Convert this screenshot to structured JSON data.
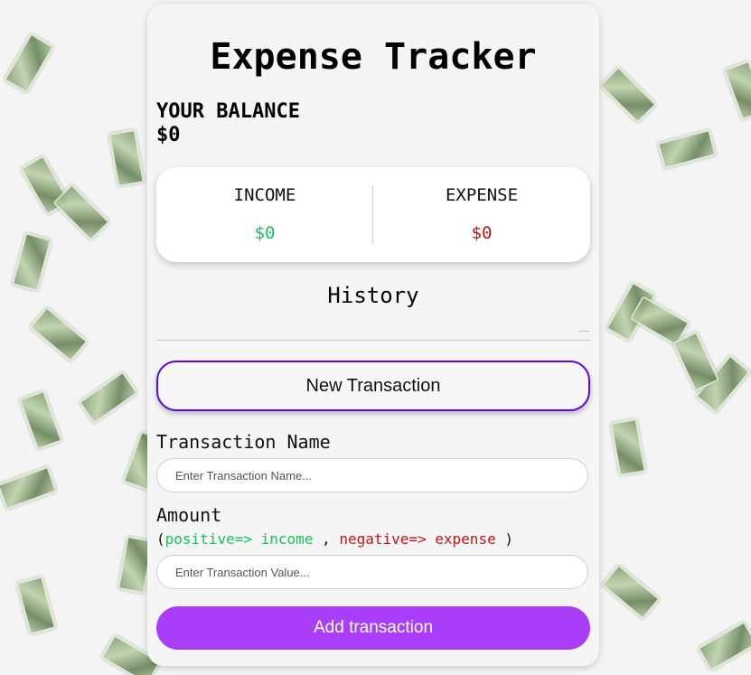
{
  "app": {
    "title": "Expense Tracker"
  },
  "balance": {
    "label": "YOUR BALANCE",
    "value": "$0"
  },
  "summary": {
    "income_label": "INCOME",
    "income_value": "$0",
    "expense_label": "EXPENSE",
    "expense_value": "$0"
  },
  "history": {
    "title": "History"
  },
  "form": {
    "new_transaction_label": "New Transaction",
    "name_label": "Transaction Name",
    "name_placeholder": "Enter Transaction Name...",
    "amount_label": "Amount",
    "hint_open": "(",
    "hint_positive": "positive=> income",
    "hint_sep": " , ",
    "hint_negative": "negative=> expense",
    "hint_close": " )",
    "value_placeholder": "Enter Transaction Value...",
    "submit_label": "Add transaction"
  },
  "colors": {
    "income": "#18c45a",
    "expense": "#c81414",
    "accent_border": "#5b08e0",
    "submit_bg": "#aa3dfa"
  },
  "background": {
    "icon": "money-bills-pattern"
  }
}
